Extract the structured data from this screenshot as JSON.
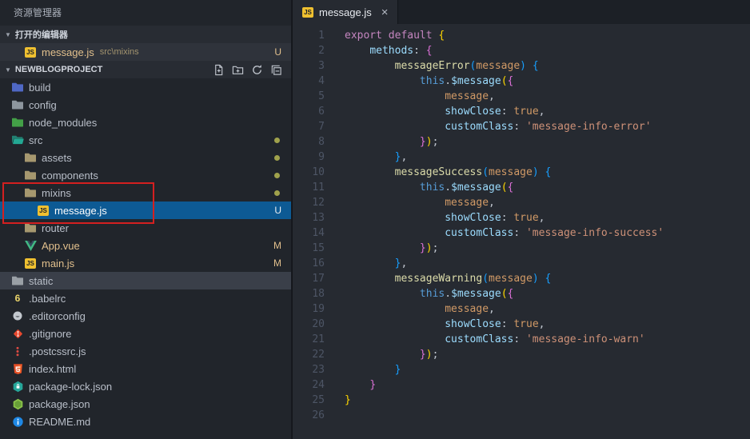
{
  "colors": {
    "selection_blue": "#0d5a94",
    "git_modified_gold": "#e2c08d",
    "annotation_red": "#d42020"
  },
  "sidebar": {
    "pane_title": "资源管理器",
    "open_editors": {
      "header": "打开的编辑器",
      "items": [
        {
          "name": "message.js",
          "path": "src\\mixins",
          "badge": "U",
          "icon": "js"
        }
      ]
    },
    "project": {
      "name": "NEWBLOGPROJECT",
      "actions": [
        {
          "id": "new-file"
        },
        {
          "id": "new-folder"
        },
        {
          "id": "refresh"
        },
        {
          "id": "collapse-all"
        }
      ]
    },
    "tree": [
      {
        "label": "build",
        "icon": "folder-build",
        "indent": 0
      },
      {
        "label": "config",
        "icon": "folder-config",
        "indent": 0
      },
      {
        "label": "node_modules",
        "icon": "folder-node",
        "indent": 0
      },
      {
        "label": "src",
        "icon": "folder-src-open",
        "indent": 0,
        "dot": true
      },
      {
        "label": "assets",
        "icon": "folder",
        "indent": 1,
        "dot": true
      },
      {
        "label": "components",
        "icon": "folder",
        "indent": 1,
        "dot": true
      },
      {
        "label": "mixins",
        "icon": "folder",
        "indent": 1,
        "dot": true
      },
      {
        "label": "message.js",
        "icon": "js",
        "indent": 2,
        "badge": "U",
        "selected": true
      },
      {
        "label": "router",
        "icon": "folder",
        "indent": 1
      },
      {
        "label": "App.vue",
        "icon": "vue",
        "indent": 1,
        "badge": "M",
        "modified": true
      },
      {
        "label": "main.js",
        "icon": "js",
        "indent": 1,
        "badge": "M",
        "modified": true
      },
      {
        "label": "static",
        "icon": "folder-static",
        "indent": 0,
        "hover": true
      },
      {
        "label": ".babelrc",
        "icon": "babel",
        "indent": 0
      },
      {
        "label": ".editorconfig",
        "icon": "editorconfig",
        "indent": 0
      },
      {
        "label": ".gitignore",
        "icon": "git",
        "indent": 0
      },
      {
        "label": ".postcssrc.js",
        "icon": "postcss",
        "indent": 0
      },
      {
        "label": "index.html",
        "icon": "html",
        "indent": 0
      },
      {
        "label": "package-lock.json",
        "icon": "npm-lock",
        "indent": 0
      },
      {
        "label": "package.json",
        "icon": "npm",
        "indent": 0
      },
      {
        "label": "README.md",
        "icon": "readme",
        "indent": 0
      }
    ]
  },
  "editor": {
    "tab": {
      "label": "message.js",
      "icon": "js",
      "close_glyph": "×"
    },
    "code_lines": [
      [
        [
          "kw",
          "export"
        ],
        [
          "p",
          " "
        ],
        [
          "kw",
          "default"
        ],
        [
          "p",
          " "
        ],
        [
          "b1",
          "{"
        ]
      ],
      [
        [
          "p",
          "    "
        ],
        [
          "prop",
          "methods"
        ],
        [
          "p",
          ": "
        ],
        [
          "b2",
          "{"
        ]
      ],
      [
        [
          "p",
          "        "
        ],
        [
          "fn",
          "messageError"
        ],
        [
          "b3",
          "("
        ],
        [
          "var",
          "message"
        ],
        [
          "b3",
          ")"
        ],
        [
          "p",
          " "
        ],
        [
          "b3",
          "{"
        ]
      ],
      [
        [
          "p",
          "            "
        ],
        [
          "this",
          "this"
        ],
        [
          "p",
          "."
        ],
        [
          "prop",
          "$message"
        ],
        [
          "b1",
          "("
        ],
        [
          "b2",
          "{"
        ]
      ],
      [
        [
          "p",
          "                "
        ],
        [
          "var",
          "message"
        ],
        [
          "p",
          ","
        ]
      ],
      [
        [
          "p",
          "                "
        ],
        [
          "prop",
          "showClose"
        ],
        [
          "p",
          ": "
        ],
        [
          "bool",
          "true"
        ],
        [
          "p",
          ","
        ]
      ],
      [
        [
          "p",
          "                "
        ],
        [
          "prop",
          "customClass"
        ],
        [
          "p",
          ": "
        ],
        [
          "str",
          "'message-info-error'"
        ]
      ],
      [
        [
          "p",
          "            "
        ],
        [
          "b2",
          "}"
        ],
        [
          "b1",
          ")"
        ],
        [
          "p",
          ";"
        ]
      ],
      [
        [
          "p",
          "        "
        ],
        [
          "b3",
          "}"
        ],
        [
          "p",
          ","
        ]
      ],
      [
        [
          "p",
          "        "
        ],
        [
          "fn",
          "messageSuccess"
        ],
        [
          "b3",
          "("
        ],
        [
          "var",
          "message"
        ],
        [
          "b3",
          ")"
        ],
        [
          "p",
          " "
        ],
        [
          "b3",
          "{"
        ]
      ],
      [
        [
          "p",
          "            "
        ],
        [
          "this",
          "this"
        ],
        [
          "p",
          "."
        ],
        [
          "prop",
          "$message"
        ],
        [
          "b1",
          "("
        ],
        [
          "b2",
          "{"
        ]
      ],
      [
        [
          "p",
          "                "
        ],
        [
          "var",
          "message"
        ],
        [
          "p",
          ","
        ]
      ],
      [
        [
          "p",
          "                "
        ],
        [
          "prop",
          "showClose"
        ],
        [
          "p",
          ": "
        ],
        [
          "bool",
          "true"
        ],
        [
          "p",
          ","
        ]
      ],
      [
        [
          "p",
          "                "
        ],
        [
          "prop",
          "customClass"
        ],
        [
          "p",
          ": "
        ],
        [
          "str",
          "'message-info-success'"
        ]
      ],
      [
        [
          "p",
          "            "
        ],
        [
          "b2",
          "}"
        ],
        [
          "b1",
          ")"
        ],
        [
          "p",
          ";"
        ]
      ],
      [
        [
          "p",
          "        "
        ],
        [
          "b3",
          "}"
        ],
        [
          "p",
          ","
        ]
      ],
      [
        [
          "p",
          "        "
        ],
        [
          "fn",
          "messageWarning"
        ],
        [
          "b3",
          "("
        ],
        [
          "var",
          "message"
        ],
        [
          "b3",
          ")"
        ],
        [
          "p",
          " "
        ],
        [
          "b3",
          "{"
        ]
      ],
      [
        [
          "p",
          "            "
        ],
        [
          "this",
          "this"
        ],
        [
          "p",
          "."
        ],
        [
          "prop",
          "$message"
        ],
        [
          "b1",
          "("
        ],
        [
          "b2",
          "{"
        ]
      ],
      [
        [
          "p",
          "                "
        ],
        [
          "var",
          "message"
        ],
        [
          "p",
          ","
        ]
      ],
      [
        [
          "p",
          "                "
        ],
        [
          "prop",
          "showClose"
        ],
        [
          "p",
          ": "
        ],
        [
          "bool",
          "true"
        ],
        [
          "p",
          ","
        ]
      ],
      [
        [
          "p",
          "                "
        ],
        [
          "prop",
          "customClass"
        ],
        [
          "p",
          ": "
        ],
        [
          "str",
          "'message-info-warn'"
        ]
      ],
      [
        [
          "p",
          "            "
        ],
        [
          "b2",
          "}"
        ],
        [
          "b1",
          ")"
        ],
        [
          "p",
          ";"
        ]
      ],
      [
        [
          "p",
          "        "
        ],
        [
          "b3",
          "}"
        ]
      ],
      [
        [
          "p",
          "    "
        ],
        [
          "b2",
          "}"
        ]
      ],
      [
        [
          "b1",
          "}"
        ]
      ],
      []
    ]
  },
  "annotation": {
    "target": "mixins folder and message.js file highlighted with red rectangle"
  }
}
